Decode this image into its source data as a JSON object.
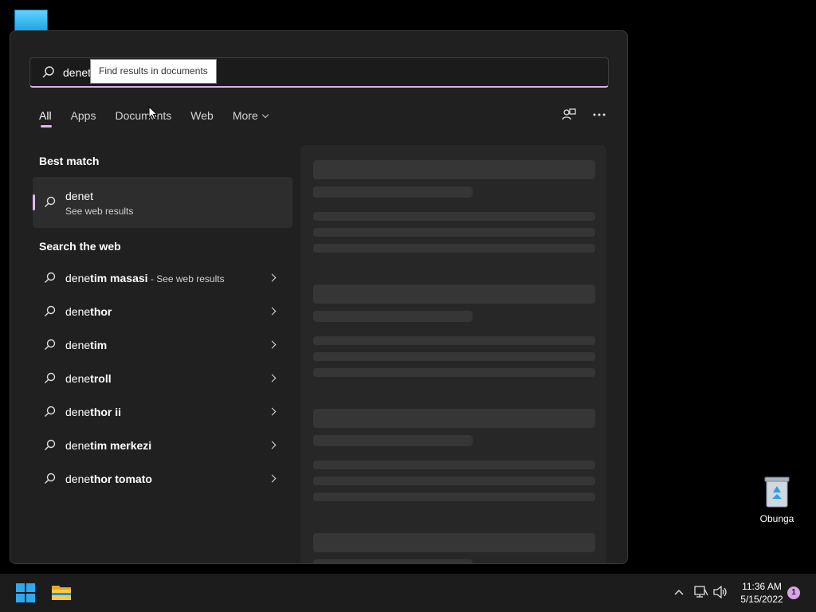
{
  "search": {
    "query": "denet",
    "tooltip": "Find results in documents"
  },
  "tabs": [
    {
      "label": "All",
      "active": true
    },
    {
      "label": "Apps"
    },
    {
      "label": "Documents"
    },
    {
      "label": "Web"
    },
    {
      "label": "More"
    }
  ],
  "best_match": {
    "title": "Best match",
    "item": {
      "label": "denet",
      "sub": "See web results"
    }
  },
  "search_web": {
    "title": "Search the web",
    "items": [
      {
        "prefix": "dene",
        "bold": "tim masasi",
        "suffix": " - See web results"
      },
      {
        "prefix": "dene",
        "bold": "thor",
        "suffix": ""
      },
      {
        "prefix": "dene",
        "bold": "tim",
        "suffix": ""
      },
      {
        "prefix": "dene",
        "bold": "troll",
        "suffix": ""
      },
      {
        "prefix": "dene",
        "bold": "thor ii",
        "suffix": ""
      },
      {
        "prefix": "dene",
        "bold": "tim merkezi",
        "suffix": ""
      },
      {
        "prefix": "dene",
        "bold": "thor tomato",
        "suffix": ""
      }
    ]
  },
  "desktop": {
    "recycle_label": "Obunga"
  },
  "taskbar": {
    "time": "11:36 AM",
    "date": "5/15/2022",
    "notification_count": "1"
  },
  "colors": {
    "accent": "#e0b8f0",
    "panel_bg": "#202020",
    "taskbar_bg": "#1c1c1c"
  }
}
